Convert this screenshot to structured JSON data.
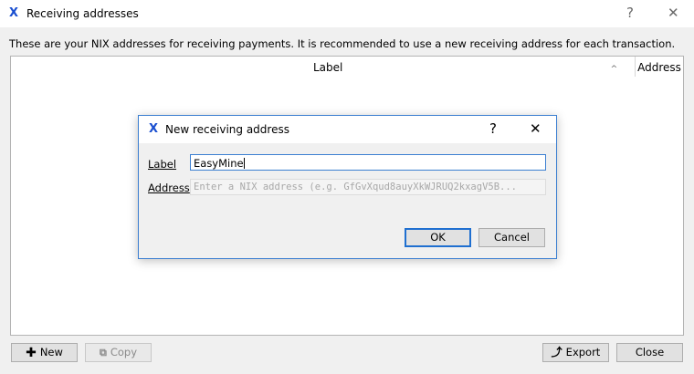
{
  "window": {
    "title": "Receiving addresses",
    "help": "?",
    "close": "✕"
  },
  "description": "These are your NIX addresses for receiving payments. It is recommended to use a new receiving address for each transaction.",
  "table": {
    "columns": [
      "Label",
      "Address"
    ],
    "rows": []
  },
  "dialog": {
    "title": "New receiving address",
    "help": "?",
    "close": "✕",
    "label_field": {
      "label": "Label",
      "value": "EasyMine"
    },
    "address_field": {
      "label": "Address",
      "placeholder": "Enter a NIX address (e.g. GfGvXqud8auyXkWJRUQ2kxagV5B..."
    },
    "ok_label": "OK",
    "cancel_label": "Cancel"
  },
  "buttons": {
    "new_label": "New",
    "copy_label": "Copy",
    "export_label": "Export",
    "close_label": "Close"
  },
  "icons": {
    "app": "nix-x-icon",
    "new": "plus-icon",
    "copy": "copy-icon",
    "export": "export-icon"
  },
  "colors": {
    "accent": "#1a4fd0",
    "focus_border": "#3c7fd1"
  }
}
